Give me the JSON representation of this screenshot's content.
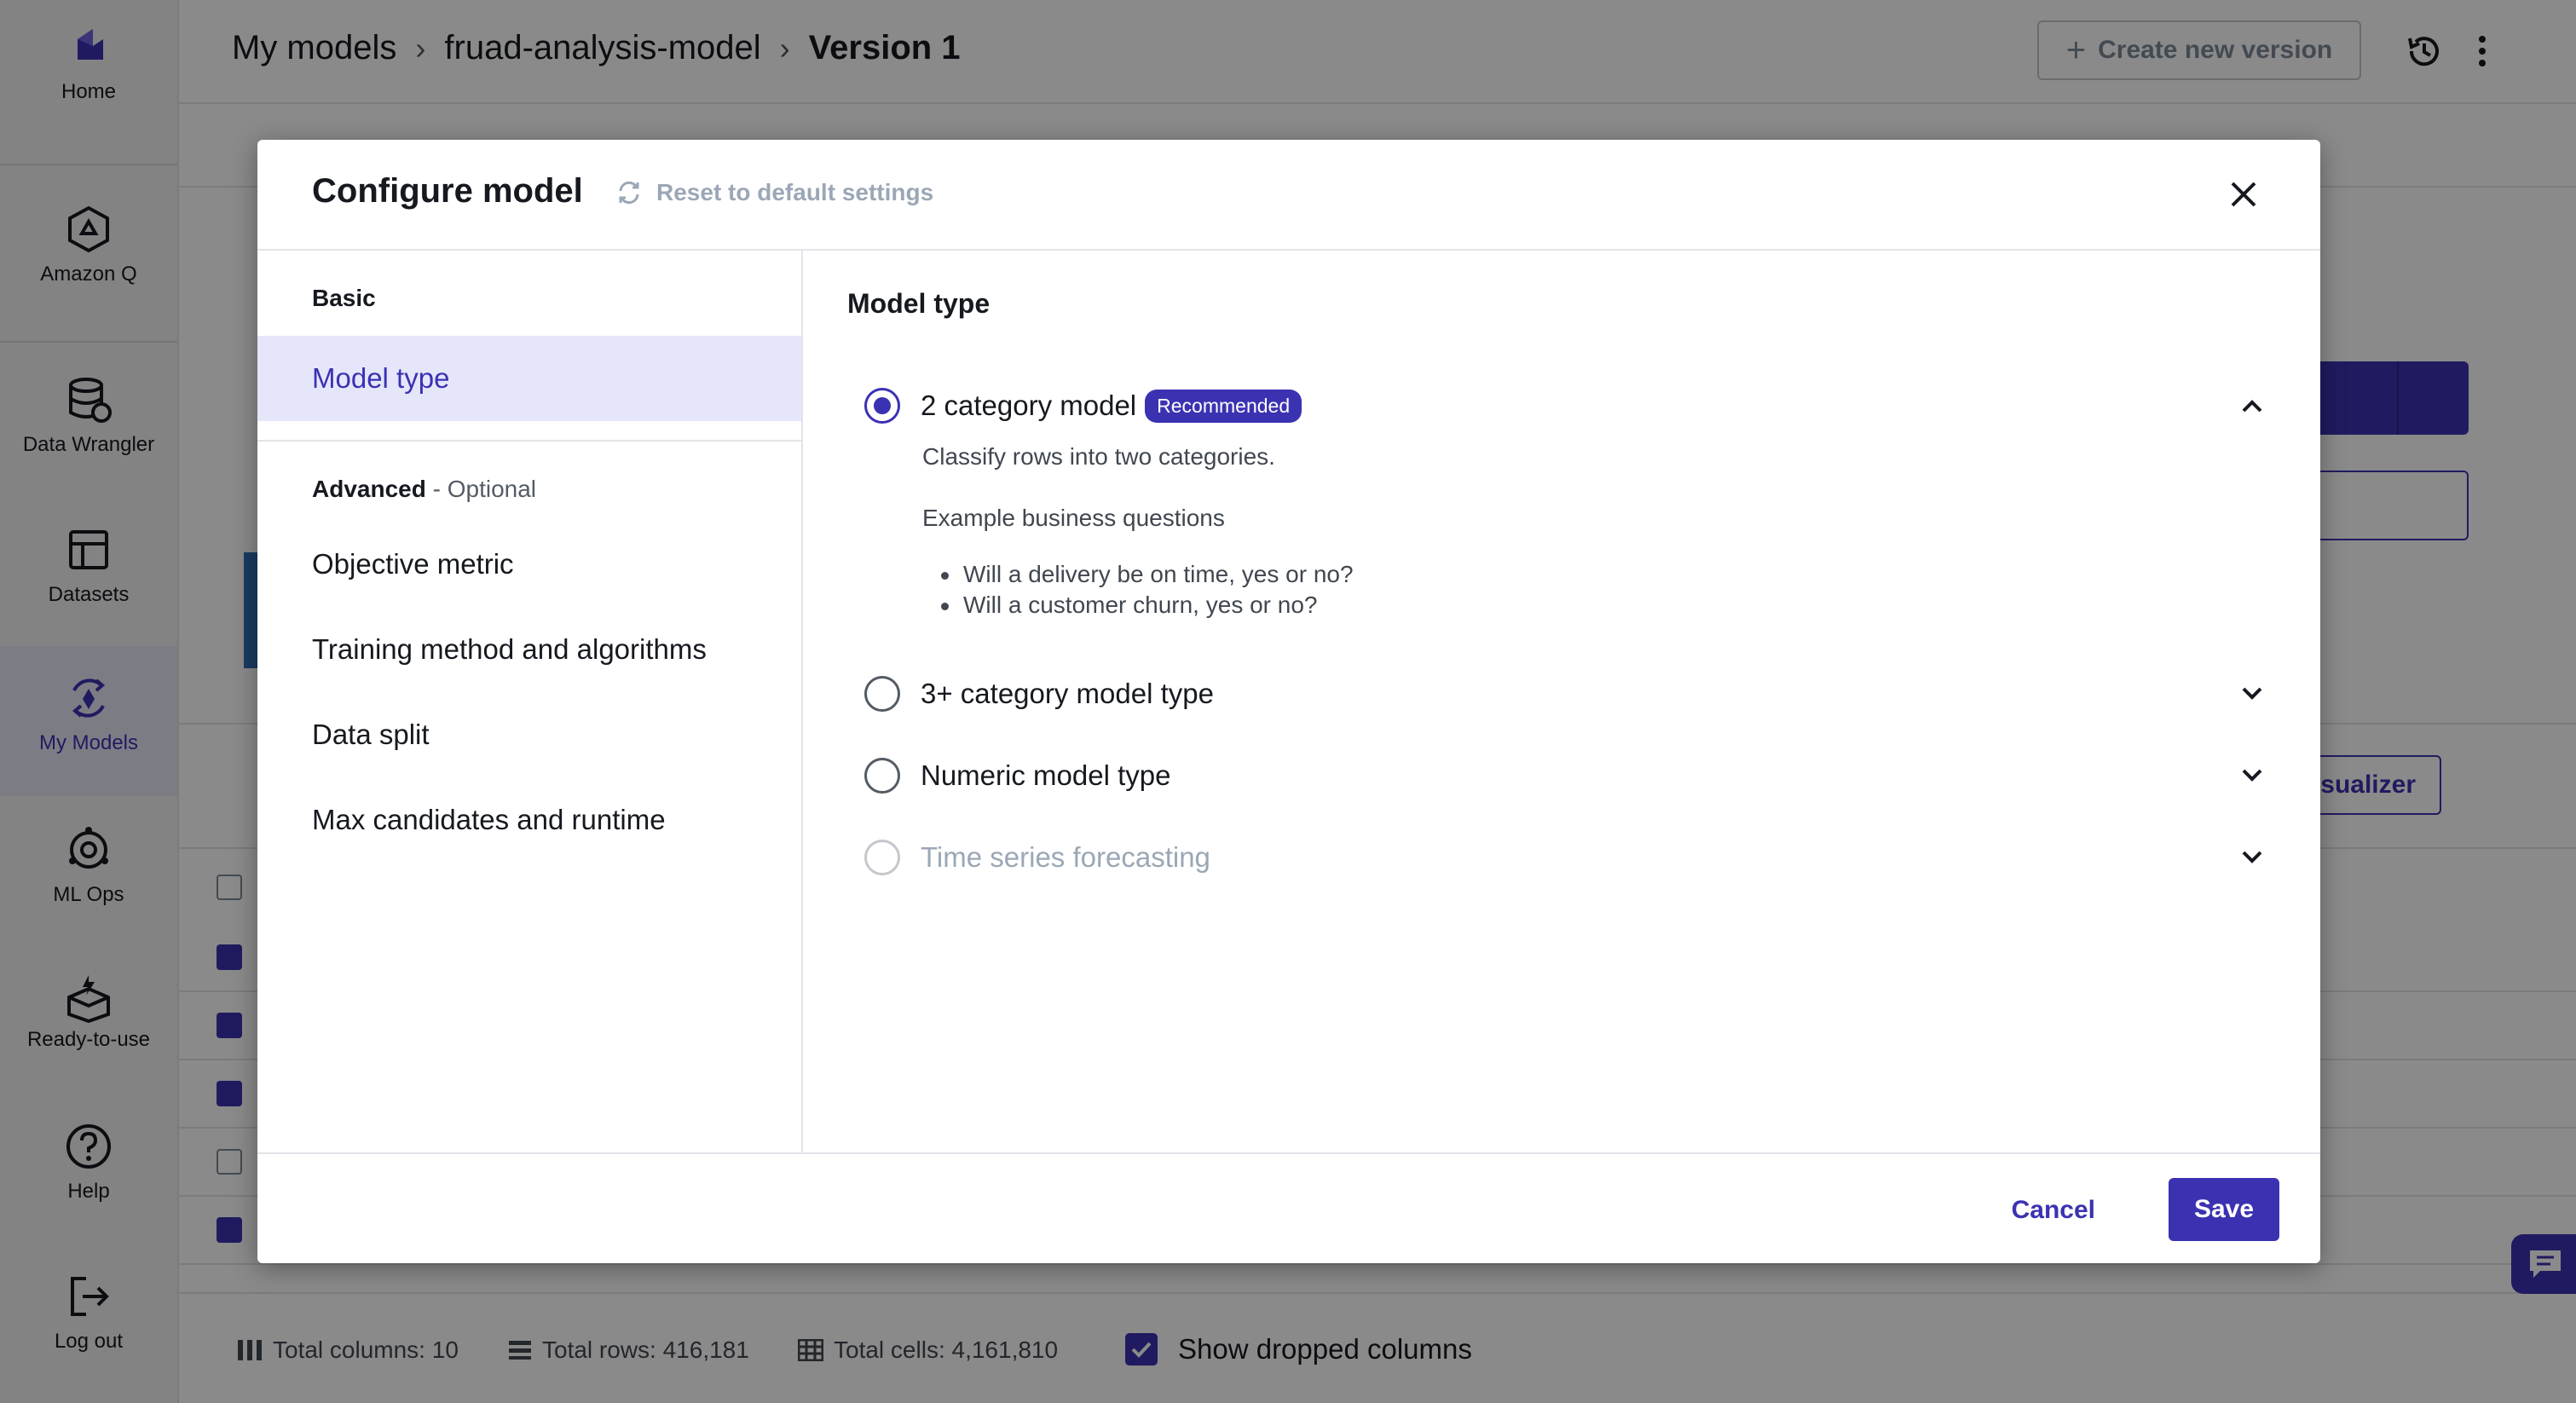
{
  "sidebar": {
    "items": [
      {
        "label": "Home",
        "icon": "home-icon"
      },
      {
        "label": "Amazon Q",
        "icon": "amazon-q-icon"
      },
      {
        "label": "Data Wrangler",
        "icon": "data-wrangler-icon"
      },
      {
        "label": "Datasets",
        "icon": "datasets-icon"
      },
      {
        "label": "My Models",
        "icon": "my-models-icon",
        "active": true
      },
      {
        "label": "ML Ops",
        "icon": "ml-ops-icon"
      },
      {
        "label": "Ready-to-use",
        "icon": "ready-to-use-icon"
      },
      {
        "label": "Help",
        "icon": "help-icon"
      },
      {
        "label": "Log out",
        "icon": "log-out-icon"
      }
    ]
  },
  "header": {
    "breadcrumbs": [
      "My models",
      "fruad-analysis-model",
      "Version 1"
    ],
    "create_version_label": "Create new version"
  },
  "footer": {
    "total_columns": "Total columns: 10",
    "total_rows": "Total rows: 416,181",
    "total_cells": "Total cells: 4,161,810",
    "show_dropped_label": "Show dropped columns"
  },
  "background": {
    "visualizer_label": "isualizer"
  },
  "modal": {
    "title": "Configure model",
    "reset_label": "Reset to default settings",
    "nav": {
      "basic_label": "Basic",
      "basic_items": [
        "Model type"
      ],
      "advanced_label": "Advanced",
      "advanced_optional": " - Optional",
      "advanced_items": [
        "Objective metric",
        "Training method and algorithms",
        "Data split",
        "Max candidates and runtime"
      ]
    },
    "section_title": "Model type",
    "options": [
      {
        "label": "2 category model",
        "badge": "Recommended",
        "selected": true,
        "expanded": true
      },
      {
        "label": "3+ category model type",
        "selected": false
      },
      {
        "label": "Numeric model type",
        "selected": false
      },
      {
        "label": "Time series forecasting",
        "selected": false,
        "disabled": true
      }
    ],
    "expanded_desc": "Classify rows into two categories.",
    "example_title": "Example business questions",
    "examples": [
      "Will a delivery be on time, yes or no?",
      "Will a customer churn, yes or no?"
    ],
    "cancel_label": "Cancel",
    "save_label": "Save"
  },
  "colors": {
    "accent": "#3b32b2",
    "badge_bg": "#3b32b2",
    "disabled_text": "#9ba7b6"
  }
}
